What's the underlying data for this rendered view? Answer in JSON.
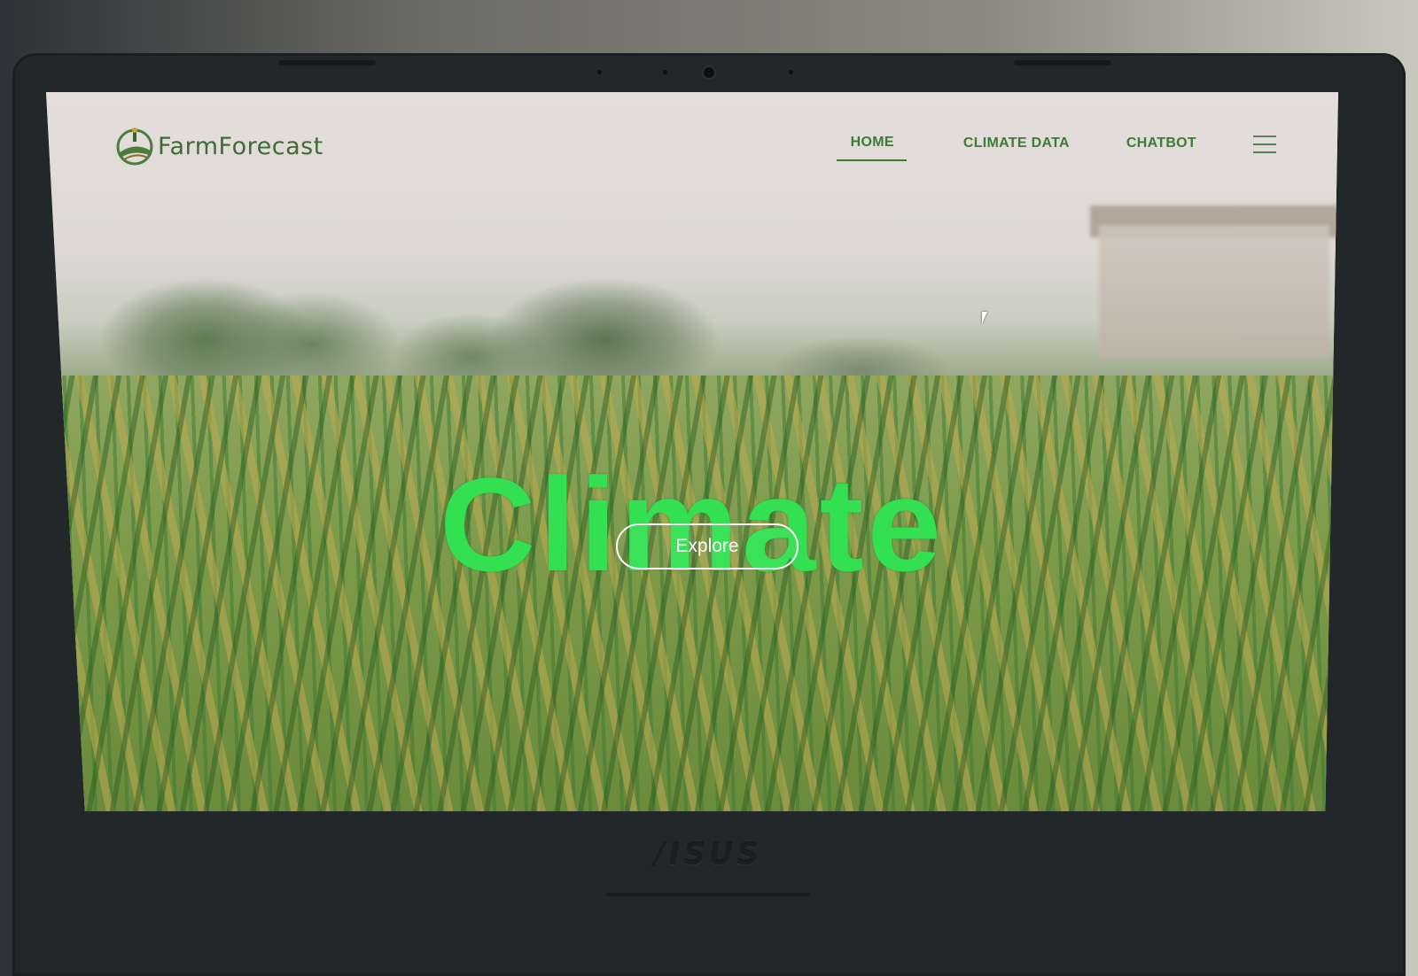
{
  "app": {
    "logo_text": "FarmForecast",
    "logo_icon": "farm-field-icon"
  },
  "nav": {
    "items": [
      {
        "label": "HOME",
        "active": true
      },
      {
        "label": "CLIMATE DATA",
        "active": false
      },
      {
        "label": "CHATBOT",
        "active": false
      }
    ],
    "menu_icon": "hamburger-icon"
  },
  "hero": {
    "title": "Climate",
    "cta_label": "Explore"
  },
  "device": {
    "brand": "/ISUS"
  },
  "colors": {
    "brand_green": "#3f7a3a",
    "title_green": "#33e052",
    "button_border": "#ffffff"
  }
}
